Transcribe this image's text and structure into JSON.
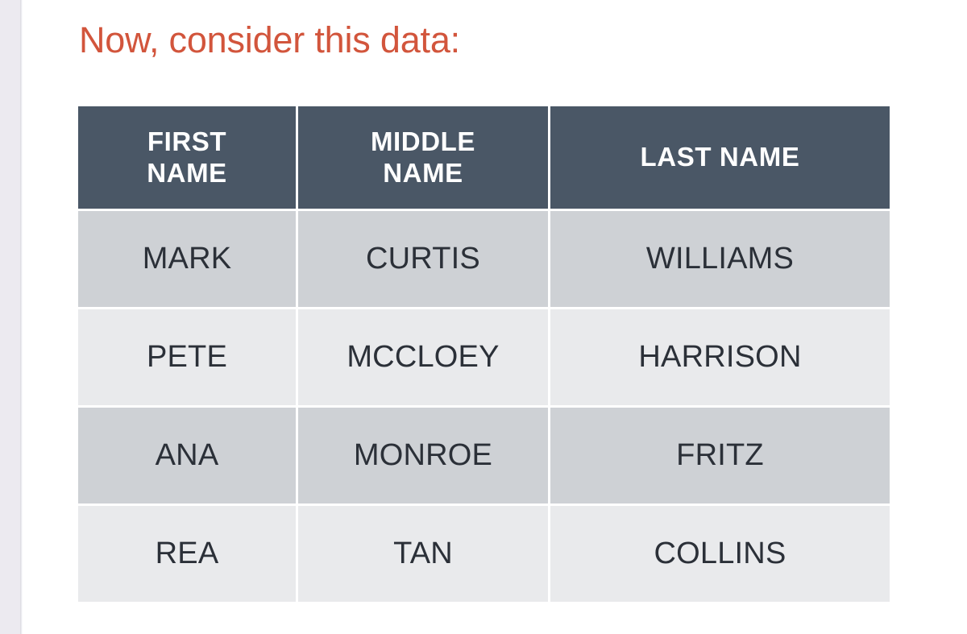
{
  "theme": {
    "title_color": "#d2553c",
    "header_bg": "#4a5766",
    "header_text": "#ffffff",
    "row_odd_bg": "#ced1d5",
    "row_even_bg": "#e9eaec",
    "cell_text": "#2b3038",
    "page_bg": "#ffffff",
    "page_edge": "#eceaf0"
  },
  "title": "Now, consider this data:",
  "table": {
    "columns": [
      {
        "id": "first",
        "line1": "FIRST",
        "line2": "NAME",
        "label": "FIRST NAME"
      },
      {
        "id": "middle",
        "line1": "MIDDLE",
        "line2": "NAME",
        "label": "MIDDLE NAME"
      },
      {
        "id": "last",
        "line1": "LAST NAME",
        "line2": "",
        "label": "LAST NAME"
      }
    ],
    "rows": [
      {
        "first": "MARK",
        "middle": "CURTIS",
        "last": "WILLIAMS"
      },
      {
        "first": "PETE",
        "middle": "MCCLOEY",
        "last": "HARRISON"
      },
      {
        "first": "ANA",
        "middle": "MONROE",
        "last": "FRITZ"
      },
      {
        "first": "REA",
        "middle": "TAN",
        "last": "COLLINS"
      }
    ]
  }
}
